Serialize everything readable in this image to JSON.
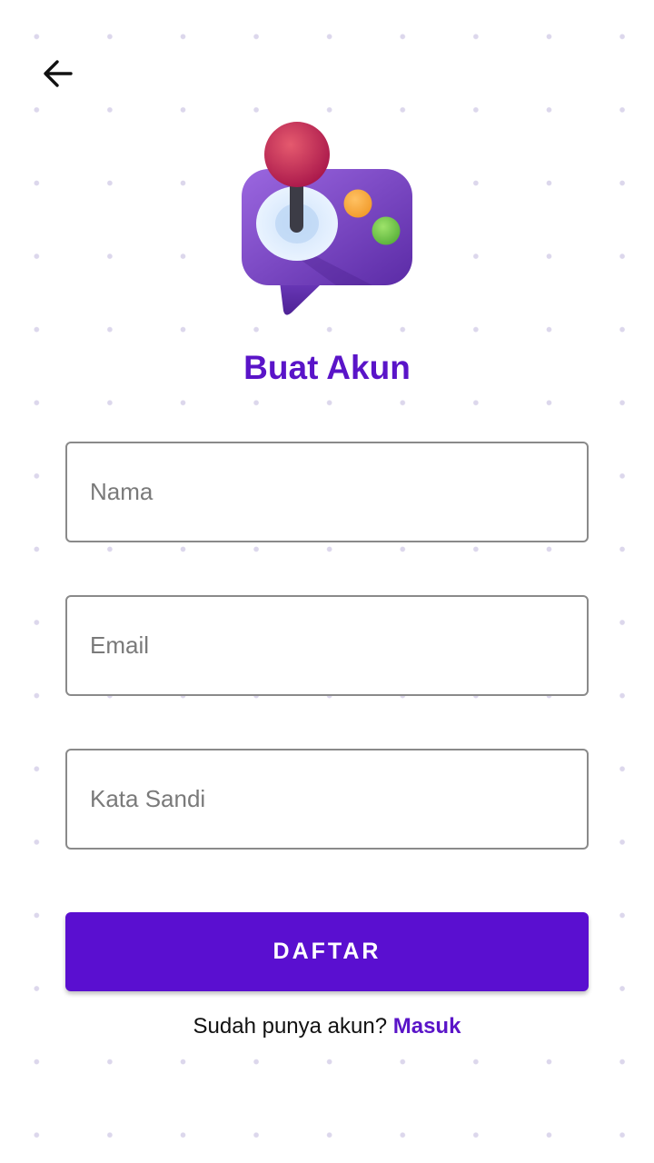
{
  "header": {
    "back_icon": "arrow-left-icon"
  },
  "logo": {
    "icon": "game-controller-chat-icon"
  },
  "title": "Buat Akun",
  "form": {
    "name_placeholder": "Nama",
    "email_placeholder": "Email",
    "password_placeholder": "Kata Sandi",
    "submit_label": "DAFTAR"
  },
  "footer": {
    "prompt": "Sudah punya akun? ",
    "login_label": "Masuk"
  },
  "colors": {
    "accent": "#5a0fd0",
    "title": "#5a14c8"
  }
}
